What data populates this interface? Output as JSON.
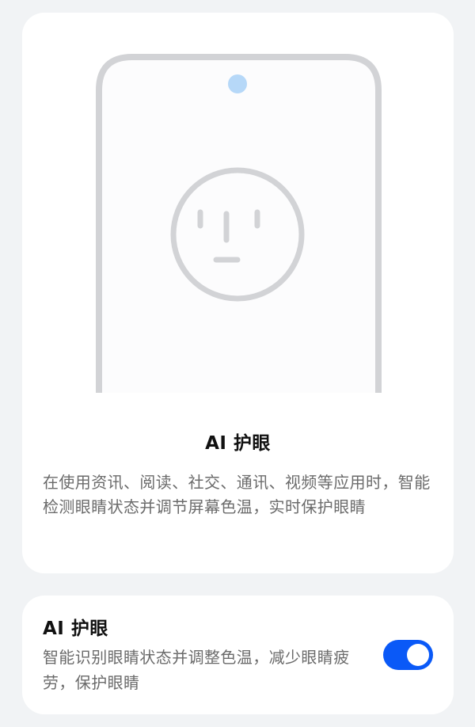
{
  "colors": {
    "page_background": "#f1f3f5",
    "card_background": "#ffffff",
    "accent": "#0a59f7",
    "phone_outline": "#d2d3d6",
    "camera_dot": "#b6d8f8"
  },
  "intro_card": {
    "illustration": {
      "device": "phone-outline",
      "icon": "neutral-face-icon"
    },
    "title": "AI 护眼",
    "description": "在使用资讯、阅读、社交、通讯、视频等应用时，智能检测眼睛状态并调节屏幕色温，实时保护眼睛"
  },
  "setting": {
    "title": "AI 护眼",
    "description": "智能识别眼睛状态并调整色温，减少眼睛疲劳，保护眼睛",
    "enabled": true
  }
}
